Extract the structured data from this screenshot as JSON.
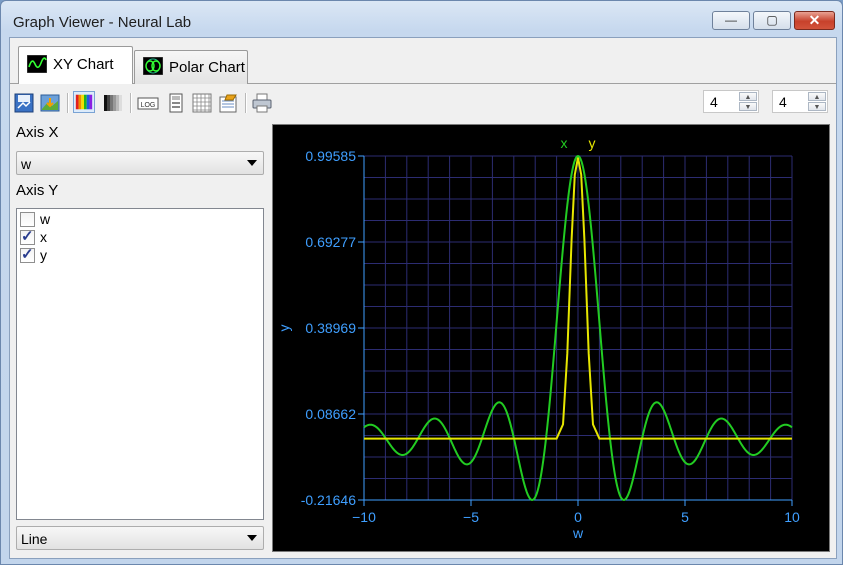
{
  "window": {
    "title": "Graph Viewer - Neural Lab",
    "min_glyph": "—",
    "max_glyph": "▢",
    "close_glyph": "✕"
  },
  "tabs": [
    {
      "label": "XY Chart",
      "icon": "xy-chart-icon",
      "active": true
    },
    {
      "label": "Polar Chart",
      "icon": "polar-chart-icon",
      "active": false
    }
  ],
  "toolbar": {
    "buttons": [
      "save-icon",
      "export-image-icon",
      "color-palette-icon",
      "grayscale-palette-icon",
      "log-scale-icon",
      "number-format-icon",
      "grid-icon",
      "edit-properties-icon",
      "print-icon"
    ],
    "log_text": "LOG",
    "spin1": "4",
    "spin2": "4"
  },
  "left": {
    "axis_x_label": "Axis X",
    "axis_x_value": "w",
    "axis_y_label": "Axis Y",
    "axis_y_items": [
      {
        "label": "w",
        "checked": false
      },
      {
        "label": "x",
        "checked": true
      },
      {
        "label": "y",
        "checked": true
      }
    ],
    "chart_style": "Line"
  },
  "chart_data": {
    "type": "line",
    "xlabel": "w",
    "ylabel": "y",
    "xlim": [
      -10,
      10
    ],
    "ylim": [
      -0.21646,
      0.99585
    ],
    "xticks": [
      "−10",
      "−5",
      "0",
      "5",
      "10"
    ],
    "yticks": [
      "0.99585",
      "0.69277",
      "0.38969",
      "0.08662",
      "-0.21646"
    ],
    "legend": [
      "x",
      "y"
    ],
    "grid": true,
    "series": [
      {
        "name": "x",
        "color": "#22cc22",
        "x": [
          -10,
          -9.5,
          -9,
          -8.5,
          -8,
          -7.5,
          -7,
          -6.5,
          -6,
          -5.5,
          -5,
          -4.5,
          -4,
          -3.5,
          -3,
          -2.5,
          -2,
          -1.5,
          -1,
          -0.5,
          0,
          0.5,
          1,
          1.5,
          2,
          2.5,
          3,
          3.5,
          4,
          4.5,
          5,
          5.5,
          6,
          6.5,
          7,
          7.5,
          8,
          8.5,
          9,
          9.5,
          10
        ],
        "y": [
          0.0,
          -0.03,
          0.02,
          0.04,
          -0.04,
          -0.03,
          0.05,
          0.02,
          -0.07,
          0.0,
          0.09,
          -0.03,
          -0.1,
          0.06,
          0.08,
          -0.11,
          -0.11,
          0.24,
          0.66,
          0.93,
          0.99,
          0.93,
          0.66,
          0.24,
          -0.11,
          -0.11,
          0.08,
          0.06,
          -0.1,
          -0.03,
          0.09,
          0.0,
          -0.07,
          0.02,
          0.05,
          -0.03,
          -0.04,
          0.04,
          0.02,
          -0.03,
          0.0
        ]
      },
      {
        "name": "y",
        "color": "#e6e600",
        "x": [
          -10,
          -2,
          -1,
          -0.7,
          -0.5,
          -0.3,
          -0.15,
          0,
          0.15,
          0.3,
          0.5,
          0.7,
          1,
          2,
          10
        ],
        "y": [
          0.0,
          0.0,
          0.0,
          0.05,
          0.3,
          0.7,
          0.93,
          0.99,
          0.93,
          0.7,
          0.3,
          0.05,
          0.0,
          0.0,
          0.0
        ]
      }
    ]
  }
}
